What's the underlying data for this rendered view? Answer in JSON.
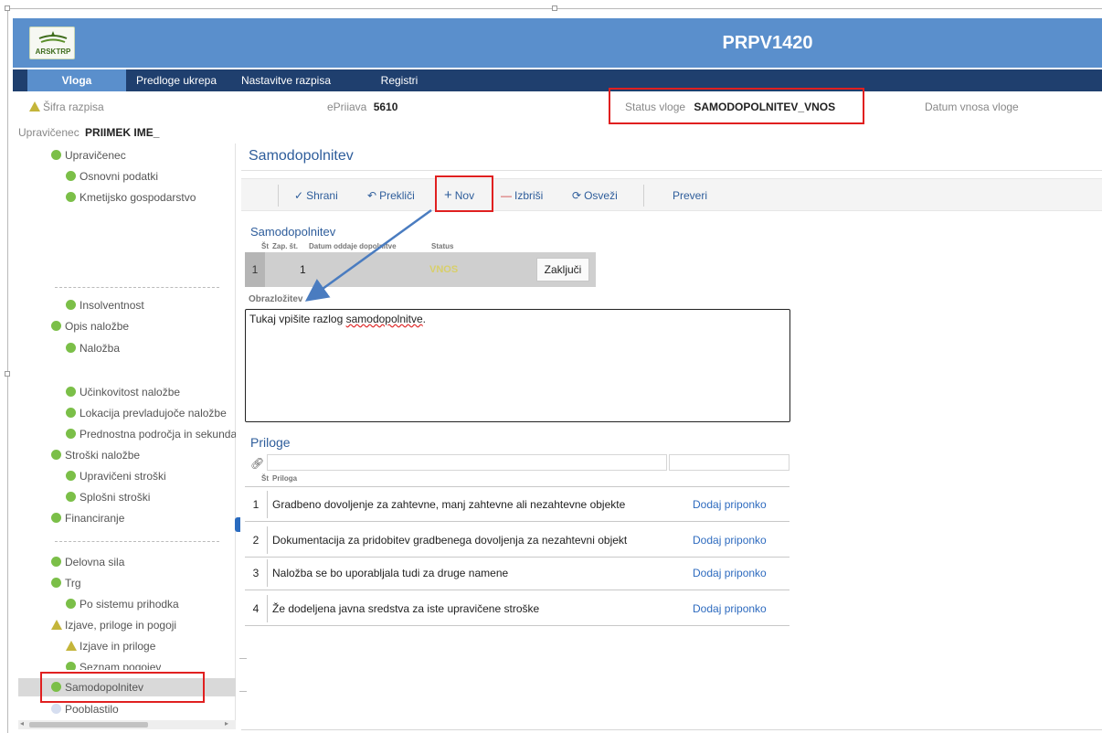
{
  "header": {
    "logo_text": "ARSKTRP",
    "app_title": "PRPV1420"
  },
  "nav": {
    "tabs": [
      {
        "label": "Vloga"
      },
      {
        "label": "Predloge ukrepa"
      },
      {
        "label": "Nastavitve razpisa"
      },
      {
        "label": "Registri"
      }
    ]
  },
  "info": {
    "sifra_label": "Šifra razpisa",
    "epriiava_label": "ePriiava",
    "epriiava_value": "5610",
    "status_label": "Status vloge",
    "status_value": "SAMODOPOLNITEV_VNOS",
    "datum_label": "Datum vnosa vloge",
    "upravicenec_label": "Upravičenec",
    "upravicenec_value": "PRIIMEK IME_"
  },
  "sidebar": {
    "items": [
      {
        "label": "Upravičenec"
      },
      {
        "label": "Osnovni podatki"
      },
      {
        "label": "Kmetijsko gospodarstvo"
      },
      {
        "label": "Insolventnost"
      },
      {
        "label": "Opis naložbe"
      },
      {
        "label": "Naložba"
      },
      {
        "label": "Učinkovitost naložbe"
      },
      {
        "label": "Lokacija prevladujoče naložbe"
      },
      {
        "label": "Prednostna področja in sekunda"
      },
      {
        "label": "Stroški naložbe"
      },
      {
        "label": "Upravičeni stroški"
      },
      {
        "label": "Splošni stroški"
      },
      {
        "label": "Financiranje"
      },
      {
        "label": "Delovna sila"
      },
      {
        "label": "Trg"
      },
      {
        "label": "Po sistemu prihodka"
      },
      {
        "label": "Izjave, priloge in pogoji"
      },
      {
        "label": "Izjave in priloge"
      },
      {
        "label": "Seznam pogojev"
      },
      {
        "label": "Samodopolnitev"
      },
      {
        "label": "Pooblastilo"
      }
    ]
  },
  "main": {
    "title": "Samodopolnitev",
    "toolbar": {
      "save": "Shrani",
      "cancel": "Prekliči",
      "new": "Nov",
      "delete": "Izbriši",
      "refresh": "Osveži",
      "check": "Preveri"
    },
    "subtitle": "Samodopolnitev",
    "grid": {
      "columns": [
        "Št",
        "Zap. št.",
        "Datum oddaje dopolnitve",
        "Status"
      ],
      "row": {
        "index": "1",
        "zap_st": "1",
        "datum": "",
        "status": "VNOS",
        "action": "Zaključi"
      }
    },
    "obrazlozitev_label": "Obrazložitev",
    "obrazlozitev_text_pre": "Tukaj vpišite razlog ",
    "obrazlozitev_text_err": "samodopolnitve",
    "obrazlozitev_text_post": "."
  },
  "priloge": {
    "title": "Priloge",
    "columns": [
      "Št",
      "Priloga"
    ],
    "rows": [
      {
        "num": "1",
        "text": "Gradbeno dovoljenje za zahtevne, manj zahtevne ali nezahtevne objekte",
        "action": "Dodaj priponko"
      },
      {
        "num": "2",
        "text": "Dokumentacija za pridobitev gradbenega dovoljenja za nezahtevni objekt",
        "action": "Dodaj priponko"
      },
      {
        "num": "3",
        "text": "Naložba se bo uporabljala tudi za druge namene",
        "action": "Dodaj priponko"
      },
      {
        "num": "4",
        "text": "Že dodeljena javna sredstva za iste upravičene stroške",
        "action": "Dodaj priponko"
      }
    ]
  },
  "colors": {
    "header": "#5a8fcc",
    "nav": "#1f3f6e",
    "accent": "#2e5d9b",
    "highlight": "#e02020",
    "ok_dot": "#7bbf48",
    "warn": "#c4b53a"
  }
}
